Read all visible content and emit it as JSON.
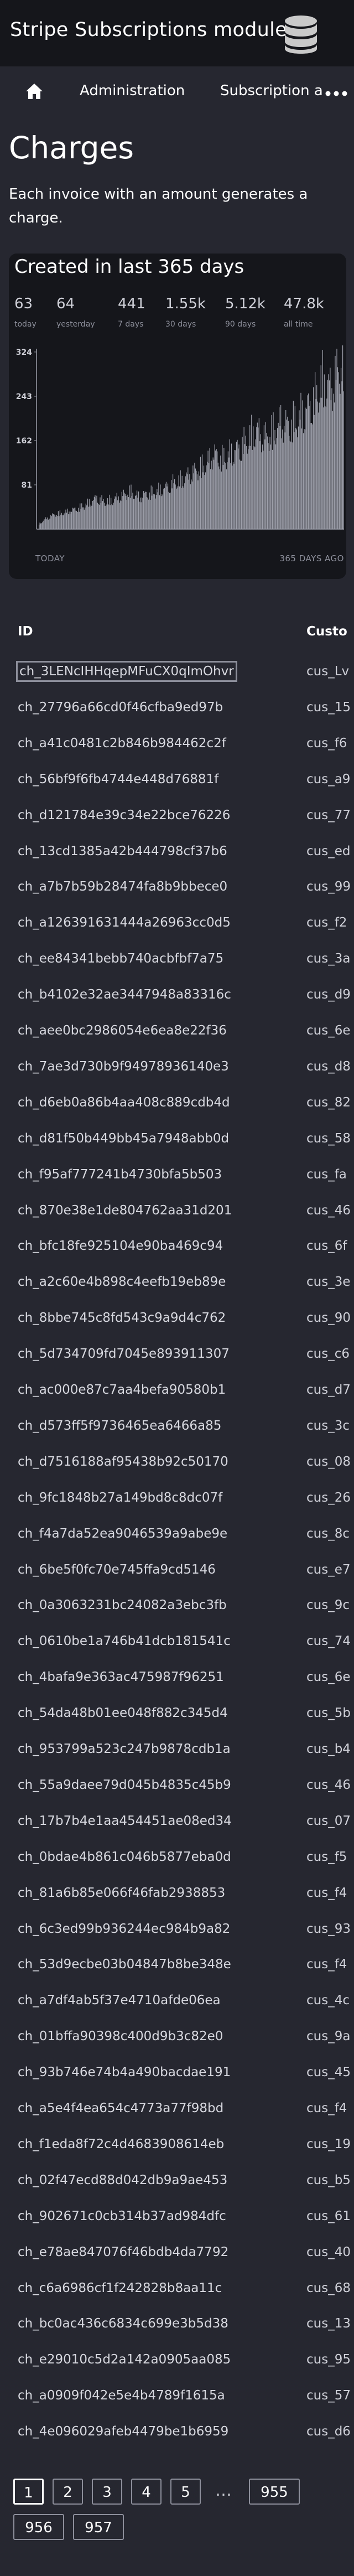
{
  "header": {
    "title": "Stripe Subscriptions module",
    "icon": "database-icon"
  },
  "nav": {
    "home_icon": "home-icon",
    "items": [
      "Administration",
      "Subscription a"
    ],
    "more_icon": "more-dots-icon"
  },
  "page": {
    "title": "Charges",
    "description": "Each invoice with an amount generates a charge."
  },
  "stats_card": {
    "title": "Created in last 365 days",
    "stats": [
      {
        "value": "63",
        "label": "today"
      },
      {
        "value": "64",
        "label": "yesterday"
      },
      {
        "value": "441",
        "label": "7 days"
      },
      {
        "value": "1.55k",
        "label": "30 days"
      },
      {
        "value": "5.12k",
        "label": "90 days"
      },
      {
        "value": "47.8k",
        "label": "all time"
      }
    ],
    "footer_left": "TODAY",
    "footer_right": "365 DAYS AGO"
  },
  "chart_data": {
    "type": "bar",
    "title": "Created in last 365 days",
    "ylim": [
      0,
      330
    ],
    "yticks": [
      "324",
      "243",
      "162",
      "81"
    ],
    "x_start_label": "TODAY",
    "x_end_label": "365 DAYS AGO",
    "anchors": [
      [
        0,
        315
      ],
      [
        8,
        290
      ],
      [
        15,
        260
      ],
      [
        25,
        275
      ],
      [
        35,
        240
      ],
      [
        45,
        220
      ],
      [
        55,
        205
      ],
      [
        65,
        190
      ],
      [
        75,
        200
      ],
      [
        85,
        180
      ],
      [
        95,
        170
      ],
      [
        105,
        185
      ],
      [
        115,
        165
      ],
      [
        125,
        150
      ],
      [
        135,
        140
      ],
      [
        145,
        130
      ],
      [
        155,
        140
      ],
      [
        165,
        120
      ],
      [
        175,
        110
      ],
      [
        185,
        100
      ],
      [
        195,
        90
      ],
      [
        205,
        85
      ],
      [
        215,
        75
      ],
      [
        225,
        70
      ],
      [
        235,
        65
      ],
      [
        245,
        60
      ],
      [
        255,
        70
      ],
      [
        265,
        62
      ],
      [
        275,
        55
      ],
      [
        285,
        50
      ],
      [
        295,
        58
      ],
      [
        305,
        48
      ],
      [
        315,
        40
      ],
      [
        325,
        35
      ],
      [
        335,
        30
      ],
      [
        345,
        28
      ],
      [
        355,
        20
      ],
      [
        364,
        10
      ]
    ]
  },
  "table": {
    "columns": [
      "ID",
      "Custo"
    ],
    "rows": [
      [
        "ch_3LENcIHHqepMFuCX0qImOhvr",
        "cus_Lv"
      ],
      [
        "ch_27796a66cd0f46cfba9ed97b",
        "cus_15"
      ],
      [
        "ch_a41c0481c2b846b984462c2f",
        "cus_f6"
      ],
      [
        "ch_56bf9f6fb4744e448d76881f",
        "cus_a9"
      ],
      [
        "ch_d121784e39c34e22bce76226",
        "cus_77"
      ],
      [
        "ch_13cd1385a42b444798cf37b6",
        "cus_ed"
      ],
      [
        "ch_a7b7b59b28474fa8b9bbece0",
        "cus_99"
      ],
      [
        "ch_a126391631444a26963cc0d5",
        "cus_f2"
      ],
      [
        "ch_ee84341bebb740acbfbf7a75",
        "cus_3a"
      ],
      [
        "ch_b4102e32ae3447948a83316c",
        "cus_d9"
      ],
      [
        "ch_aee0bc2986054e6ea8e22f36",
        "cus_6e"
      ],
      [
        "ch_7ae3d730b9f94978936140e3",
        "cus_d8"
      ],
      [
        "ch_d6eb0a86b4aa408c889cdb4d",
        "cus_82"
      ],
      [
        "ch_d81f50b449bb45a7948abb0d",
        "cus_58"
      ],
      [
        "ch_f95af777241b4730bfa5b503",
        "cus_fa"
      ],
      [
        "ch_870e38e1de804762aa31d201",
        "cus_46"
      ],
      [
        "ch_bfc18fe925104e90ba469c94",
        "cus_6f"
      ],
      [
        "ch_a2c60e4b898c4eefb19eb89e",
        "cus_3e"
      ],
      [
        "ch_8bbe745c8fd543c9a9d4c762",
        "cus_90"
      ],
      [
        "ch_5d734709fd7045e893911307",
        "cus_c6"
      ],
      [
        "ch_ac000e87c7aa4befa90580b1",
        "cus_d7"
      ],
      [
        "ch_d573ff5f9736465ea6466a85",
        "cus_3c"
      ],
      [
        "ch_d7516188af95438b92c50170",
        "cus_08"
      ],
      [
        "ch_9fc1848b27a149bd8c8dc07f",
        "cus_26"
      ],
      [
        "ch_f4a7da52ea9046539a9abe9e",
        "cus_8c"
      ],
      [
        "ch_6be5f0fc70e745ffa9cd5146",
        "cus_e7"
      ],
      [
        "ch_0a3063231bc24082a3ebc3fb",
        "cus_9c"
      ],
      [
        "ch_0610be1a746b41dcb181541c",
        "cus_74"
      ],
      [
        "ch_4bafa9e363ac475987f96251",
        "cus_6e"
      ],
      [
        "ch_54da48b01ee048f882c345d4",
        "cus_5b"
      ],
      [
        "ch_953799a523c247b9878cdb1a",
        "cus_b4"
      ],
      [
        "ch_55a9daee79d045b4835c45b9",
        "cus_46"
      ],
      [
        "ch_17b7b4e1aa454451ae08ed34",
        "cus_07"
      ],
      [
        "ch_0bdae4b861c046b5877eba0d",
        "cus_f5"
      ],
      [
        "ch_81a6b85e066f46fab2938853",
        "cus_f4"
      ],
      [
        "ch_6c3ed99b936244ec984b9a82",
        "cus_93"
      ],
      [
        "ch_53d9ecbe03b04847b8be348e",
        "cus_f4"
      ],
      [
        "ch_a7df4ab5f37e4710afde06ea",
        "cus_4c"
      ],
      [
        "ch_01bffa90398c400d9b3c82e0",
        "cus_9a"
      ],
      [
        "ch_93b746e74b4a490bacdae191",
        "cus_45"
      ],
      [
        "ch_a5e4f4ea654c4773a77f98bd",
        "cus_f4"
      ],
      [
        "ch_f1eda8f72c4d4683908614eb",
        "cus_19"
      ],
      [
        "ch_02f47ecd88d042db9a9ae453",
        "cus_b5"
      ],
      [
        "ch_902671c0cb314b37ad984dfc",
        "cus_61"
      ],
      [
        "ch_e78ae847076f46bdb4da7792",
        "cus_40"
      ],
      [
        "ch_c6a6986cf1f242828b8aa11c",
        "cus_68"
      ],
      [
        "ch_bc0ac436c6834c699e3b5d38",
        "cus_13"
      ],
      [
        "ch_e29010c5d2a142a0905aa085",
        "cus_95"
      ],
      [
        "ch_a0909f042e5e4b4789f1615a",
        "cus_57"
      ],
      [
        "ch_4e096029afeb4479be1b6959",
        "cus_d6"
      ]
    ]
  },
  "pagination": {
    "pages": [
      "1",
      "2",
      "3",
      "4",
      "5",
      "955",
      "956",
      "957"
    ],
    "ellipsis": "…",
    "current": "1"
  }
}
